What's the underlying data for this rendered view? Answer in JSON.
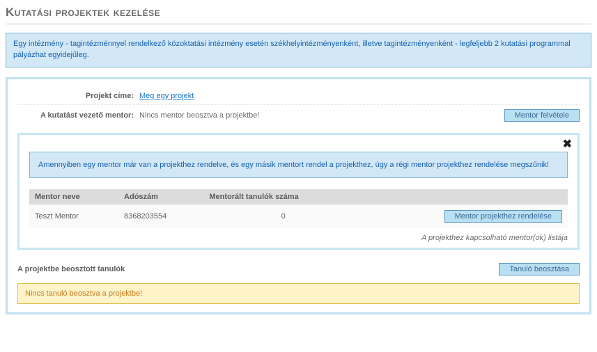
{
  "page": {
    "title": "Kutatási projektek kezelése"
  },
  "info_banner": "Egy intézmény - tagintézménnyel rendelkező közoktatási intézmény esetén székhelyintézményenként, illetve tagintézményenként - legfeljebb 2 kutatási programmal pályázhat egyidejűleg.",
  "project": {
    "title_label": "Projekt címe:",
    "title_link": "Még egy projekt",
    "mentor_label": "A kutatást vezető mentor:",
    "mentor_value": "Nincs mentor beosztva a projektbe!",
    "mentor_add_btn": "Mentor felvétele"
  },
  "mentor_panel": {
    "info": "Amennyiben egy mentor már van a projekthez rendelve, és egy másik mentort rendel a projekthez, úgy a régi mentor projekthez rendelése megszűnik!",
    "headers": {
      "name": "Mentor neve",
      "tax": "Adószám",
      "count": "Mentorált tanulók száma"
    },
    "rows": [
      {
        "name": "Teszt Mentor",
        "tax": "8368203554",
        "count": "0",
        "assign_btn": "Mentor projekthez rendelése"
      }
    ],
    "list_caption": "A projekthez kapcsolható mentor(ok) listája"
  },
  "students": {
    "label": "A projektbe beosztott tanulók",
    "add_btn": "Tanuló beosztása",
    "empty_warn": "Nincs tanuló beosztva a projektbe!"
  }
}
